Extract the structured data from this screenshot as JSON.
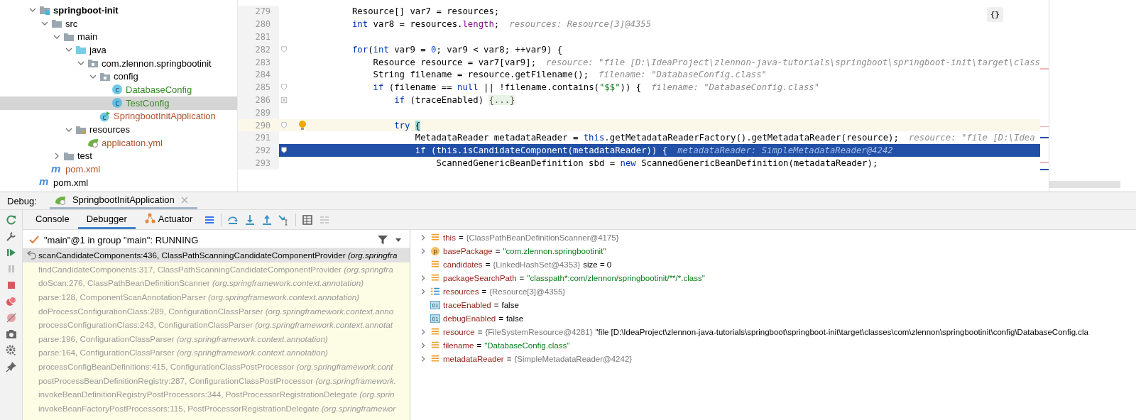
{
  "project_tree": {
    "items": [
      {
        "label": "springboot-init",
        "kind": "module",
        "bold": true,
        "expanded": true,
        "selected": false,
        "children": [
          {
            "label": "src",
            "kind": "folder",
            "expanded": true,
            "selected": false,
            "children": [
              {
                "label": "main",
                "kind": "folder",
                "expanded": true,
                "selected": false,
                "children": [
                  {
                    "label": "java",
                    "kind": "source",
                    "expanded": true,
                    "selected": false,
                    "children": [
                      {
                        "label": "com.zlennon.springbootinit",
                        "kind": "package",
                        "expanded": true,
                        "selected": false,
                        "children": [
                          {
                            "label": "config",
                            "kind": "package",
                            "expanded": true,
                            "selected": false,
                            "children": [
                              {
                                "label": "DatabaseConfig",
                                "kind": "class",
                                "icon_text": "c",
                                "selected": false,
                                "color": "#3a8a2a"
                              },
                              {
                                "label": "TestConfig",
                                "kind": "class",
                                "icon_text": "c",
                                "selected": true,
                                "color": "#3a8a2a"
                              }
                            ]
                          },
                          {
                            "label": "SpringbootInitApplication",
                            "kind": "application",
                            "icon_text": "c",
                            "selected": false,
                            "color": "#b0522b"
                          }
                        ]
                      }
                    ]
                  },
                  {
                    "label": "resources",
                    "kind": "resources",
                    "expanded": true,
                    "selected": false,
                    "children": [
                      {
                        "label": "application.yml",
                        "kind": "yaml",
                        "selected": false,
                        "color": "#b0522b"
                      }
                    ]
                  }
                ]
              },
              {
                "label": "test",
                "kind": "folder",
                "expanded": false,
                "selected": false
              }
            ]
          },
          {
            "label": "pom.xml",
            "kind": "maven",
            "icon_text": "m",
            "selected": false,
            "color": "#b0522b"
          }
        ]
      },
      {
        "label": "pom.xml",
        "kind": "maven",
        "icon_text": "m",
        "selected": false
      }
    ]
  },
  "editor": {
    "format_button": "{}",
    "lines": [
      {
        "number": "279",
        "segments": [
          {
            "kind": "plain",
            "text": "            Resource[] var7 = resources;"
          }
        ]
      },
      {
        "number": "280",
        "segments": [
          {
            "kind": "keyword",
            "text": "            int"
          },
          {
            "kind": "plain",
            "text": " var8 = resources."
          },
          {
            "kind": "field",
            "text": "length"
          },
          {
            "kind": "plain",
            "text": ";"
          }
        ],
        "hint": "resources: Resource[3]@4355"
      },
      {
        "number": "281"
      },
      {
        "number": "282",
        "folded": false,
        "segments": [
          {
            "kind": "keyword",
            "text": "            for"
          },
          {
            "kind": "plain",
            "text": "("
          },
          {
            "kind": "keyword",
            "text": "int"
          },
          {
            "kind": "plain",
            "text": " var9 = "
          },
          {
            "kind": "number",
            "text": "0"
          },
          {
            "kind": "plain",
            "text": "; var9 < var8; ++var9) {"
          }
        ]
      },
      {
        "number": "283",
        "segments": [
          {
            "kind": "plain",
            "text": "                Resource resource = var7[var9];"
          }
        ],
        "hint": "resource: \"file [D:\\IdeaProject\\zlennon-java-tutorials\\springboot\\springboot-init\\target\\class"
      },
      {
        "number": "284",
        "segments": [
          {
            "kind": "plain",
            "text": "                String filename = resource.getFilename();"
          }
        ],
        "hint": "filename: \"DatabaseConfig.class\""
      },
      {
        "number": "285",
        "folded": false,
        "segments": [
          {
            "kind": "keyword",
            "text": "                if"
          },
          {
            "kind": "plain",
            "text": " (filename == "
          },
          {
            "kind": "keyword",
            "text": "null"
          },
          {
            "kind": "plain",
            "text": " || !filename.contains("
          },
          {
            "kind": "string",
            "text": "\"$$\""
          },
          {
            "kind": "plain",
            "text": ")) {"
          }
        ],
        "hint": "filename: \"DatabaseConfig.class\""
      },
      {
        "number": "286",
        "folded": true,
        "segments": [
          {
            "kind": "keyword",
            "text": "                    if"
          },
          {
            "kind": "plain",
            "text": " (traceEnabled) "
          },
          {
            "kind": "folded",
            "text": "{...}"
          }
        ]
      },
      {
        "number": "289"
      },
      {
        "number": "290",
        "current": true,
        "bulb": true,
        "folded": false,
        "segments": [
          {
            "kind": "keyword",
            "text": "                    try "
          },
          {
            "kind": "brace",
            "text": "{"
          }
        ]
      },
      {
        "number": "291",
        "segments": [
          {
            "kind": "plain",
            "text": "                        MetadataReader metadataReader = "
          },
          {
            "kind": "keyword",
            "text": "this"
          },
          {
            "kind": "plain",
            "text": ".getMetadataReaderFactory().getMetadataReader(resource);"
          }
        ],
        "hint": "resource: \"file [D:\\Idea"
      },
      {
        "number": "292",
        "selected": true,
        "folded": false,
        "segments": [
          {
            "kind": "keyword",
            "text": "                        if"
          },
          {
            "kind": "plain",
            "text": " ("
          },
          {
            "kind": "keyword",
            "text": "this"
          },
          {
            "kind": "plain",
            "text": ".isCandidateComponent(metadataReader)) {"
          }
        ],
        "hint": "metadataReader: SimpleMetadataReader@4242"
      },
      {
        "number": "293",
        "segments": [
          {
            "kind": "plain",
            "text": "                            ScannedGenericBeanDefinition sbd = "
          },
          {
            "kind": "keyword",
            "text": "new"
          },
          {
            "kind": "plain",
            "text": " ScannedGenericBeanDefinition(metadataReader);"
          }
        ]
      }
    ]
  },
  "debug": {
    "label": "Debug:",
    "session_tabs": [
      {
        "label": "SpringbootInitApplication",
        "selected": true
      }
    ],
    "side_toolbar": [
      {
        "kind": "rerun",
        "disabled": false
      },
      {
        "kind": "wrench",
        "disabled": false
      },
      {
        "kind": "resume",
        "disabled": false
      },
      {
        "kind": "pause",
        "disabled": true
      },
      {
        "kind": "stop",
        "disabled": false
      },
      {
        "kind": "breakpoints",
        "disabled": false
      },
      {
        "kind": "mute",
        "disabled": false
      },
      {
        "kind": "camera",
        "disabled": false
      },
      {
        "kind": "settings",
        "disabled": false
      },
      {
        "kind": "pin",
        "disabled": false
      }
    ],
    "tabs": [
      {
        "label": "Console",
        "selected": false
      },
      {
        "label": "Debugger",
        "selected": true
      },
      {
        "label": "Actuator",
        "selected": false,
        "kind": "actuator"
      }
    ],
    "toolbar": [
      {
        "kind": "layout"
      },
      {
        "kind": "separator"
      },
      {
        "kind": "step-over"
      },
      {
        "kind": "step-into"
      },
      {
        "kind": "step-out"
      },
      {
        "kind": "run-to-cursor"
      },
      {
        "kind": "separator"
      },
      {
        "kind": "evaluate"
      },
      {
        "kind": "trace"
      }
    ],
    "thread": "\"main\"@1 in group \"main\": RUNNING",
    "frames": [
      {
        "text": "scanCandidateComponents:436, ClassPathScanningCandidateComponentProvider *(org.springfra*",
        "selected": true
      },
      {
        "text": "findCandidateComponents:317, ClassPathScanningCandidateComponentProvider *(org.springfra*",
        "selected": false
      },
      {
        "text": "doScan:276, ClassPathBeanDefinitionScanner *(org.springframework.context.annotation)*",
        "selected": false
      },
      {
        "text": "parse:128, ComponentScanAnnotationParser *(org.springframework.context.annotation)*",
        "selected": false
      },
      {
        "text": "doProcessConfigurationClass:289, ConfigurationClassParser *(org.springframework.context.anno*",
        "selected": false
      },
      {
        "text": "processConfigurationClass:243, ConfigurationClassParser *(org.springframework.context.annotat*",
        "selected": false
      },
      {
        "text": "parse:196, ConfigurationClassParser *(org.springframework.context.annotation)*",
        "selected": false
      },
      {
        "text": "parse:164, ConfigurationClassParser *(org.springframework.context.annotation)*",
        "selected": false
      },
      {
        "text": "processConfigBeanDefinitions:415, ConfigurationClassPostProcessor *(org.springframework.cont*",
        "selected": false
      },
      {
        "text": "postProcessBeanDefinitionRegistry:287, ConfigurationClassPostProcessor *(org.springframework.*",
        "selected": false
      },
      {
        "text": "invokeBeanDefinitionRegistryPostProcessors:344, PostProcessorRegistrationDelegate *(org.sprin*",
        "selected": false
      },
      {
        "text": "invokeBeanFactoryPostProcessors:115, PostProcessorRegistrationDelegate *(org.springframewor*",
        "selected": false
      }
    ],
    "variables": [
      {
        "kind": "field",
        "name": "this",
        "operator": "=",
        "value": {
          "kind": "object",
          "text": "{ClassPathBeanDefinitionScanner@4175}"
        },
        "expanded": false
      },
      {
        "kind": "parameter",
        "icon_text": "p",
        "name": "basePackage",
        "operator": "=",
        "value": {
          "kind": "string",
          "text": "\"com.zlennon.springbootinit\""
        },
        "expanded": false
      },
      {
        "kind": "field",
        "name": "candidates",
        "operator": "=",
        "value": {
          "kind": "object",
          "text": "{LinkedHashSet@4353}"
        },
        "extra": "size = 0"
      },
      {
        "kind": "field",
        "name": "packageSearchPath",
        "operator": "=",
        "value": {
          "kind": "string",
          "text": "\"classpath*:com/zlennon/springbootinit/**/*.class\""
        },
        "expanded": false
      },
      {
        "kind": "array",
        "name": "resources",
        "operator": "=",
        "value": {
          "kind": "object",
          "text": "{Resource[3]@4355}"
        },
        "expanded": false
      },
      {
        "kind": "primitive",
        "icon_text": "01",
        "name": "traceEnabled",
        "operator": "=",
        "value": {
          "kind": "boolean",
          "text": "false"
        }
      },
      {
        "kind": "primitive",
        "icon_text": "01",
        "name": "debugEnabled",
        "operator": "=",
        "value": {
          "kind": "boolean",
          "text": "false"
        }
      },
      {
        "kind": "field",
        "name": "resource",
        "operator": "=",
        "value": {
          "kind": "object",
          "text": "{FileSystemResource@4281}"
        },
        "expanded": false,
        "extra": "\"file [D:\\IdeaProject\\zlennon-java-tutorials\\springboot\\springboot-init\\target\\classes\\com\\zlennon\\springbootinit\\config\\DatabaseConfig.cla"
      },
      {
        "kind": "field",
        "name": "filename",
        "operator": "=",
        "value": {
          "kind": "string",
          "text": "\"DatabaseConfig.class\""
        },
        "expanded": false
      },
      {
        "kind": "field",
        "name": "metadataReader",
        "operator": "=",
        "value": {
          "kind": "object",
          "text": "{SimpleMetadataReader@4242}"
        },
        "expanded": false
      }
    ]
  }
}
